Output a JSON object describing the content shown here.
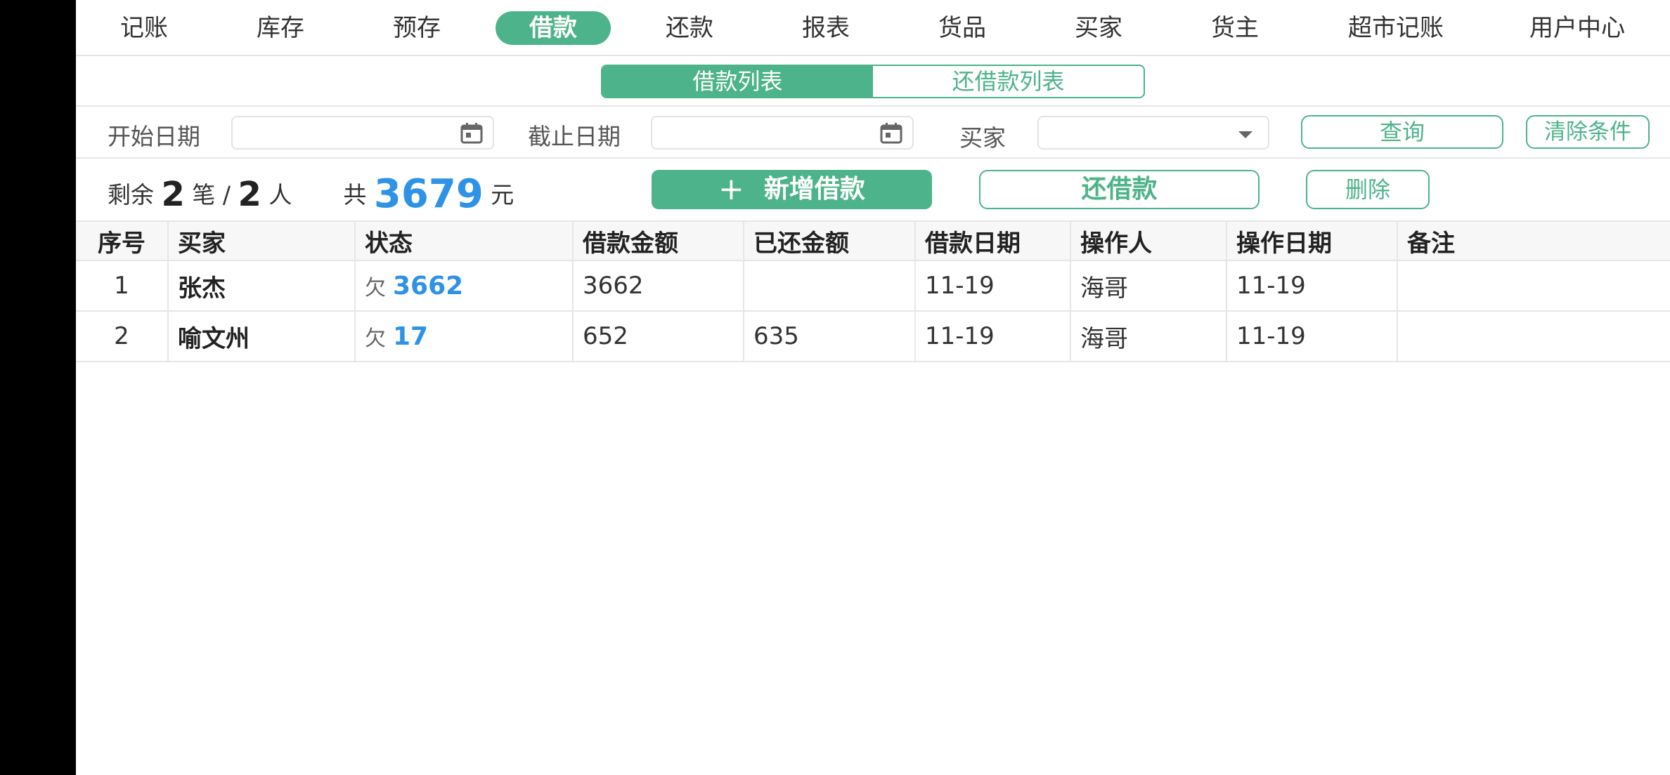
{
  "nav": {
    "items": [
      {
        "label": "记账",
        "active": false
      },
      {
        "label": "库存",
        "active": false
      },
      {
        "label": "预存",
        "active": false
      },
      {
        "label": "借款",
        "active": true
      },
      {
        "label": "还款",
        "active": false
      },
      {
        "label": "报表",
        "active": false
      },
      {
        "label": "货品",
        "active": false
      },
      {
        "label": "买家",
        "active": false
      },
      {
        "label": "货主",
        "active": false
      },
      {
        "label": "超市记账",
        "active": false
      },
      {
        "label": "用户中心",
        "active": false
      }
    ]
  },
  "subtabs": [
    {
      "label": "借款列表",
      "active": true
    },
    {
      "label": "还借款列表",
      "active": false
    }
  ],
  "filters": {
    "start_date_label": "开始日期",
    "start_date_value": "",
    "end_date_label": "截止日期",
    "end_date_value": "",
    "buyer_label": "买家",
    "buyer_value": "",
    "query_label": "查询",
    "clear_label": "清除条件"
  },
  "summary": {
    "remaining_prefix": "剩余",
    "count": "2",
    "count_unit": "笔 /",
    "people": "2",
    "people_unit": "人",
    "total_prefix": "共",
    "total": "3679",
    "total_unit": "元",
    "add_plus": "+",
    "add_label": "新增借款",
    "repay_label": "还借款",
    "delete_label": "删除"
  },
  "table": {
    "headers": [
      "序号",
      "买家",
      "状态",
      "借款金额",
      "已还金额",
      "借款日期",
      "操作人",
      "操作日期",
      "备注"
    ],
    "rows": [
      {
        "no": "1",
        "buyer": "张杰",
        "owe_label": "欠",
        "owe": "3662",
        "amount": "3662",
        "repaid": "",
        "date": "11-19",
        "operator": "海哥",
        "op_date": "11-19",
        "note": ""
      },
      {
        "no": "2",
        "buyer": "喻文州",
        "owe_label": "欠",
        "owe": "17",
        "amount": "652",
        "repaid": "635",
        "date": "11-19",
        "operator": "海哥",
        "op_date": "11-19",
        "note": ""
      }
    ]
  },
  "colors": {
    "accent": "#4db38a",
    "amount_blue": "#2e92e6"
  }
}
